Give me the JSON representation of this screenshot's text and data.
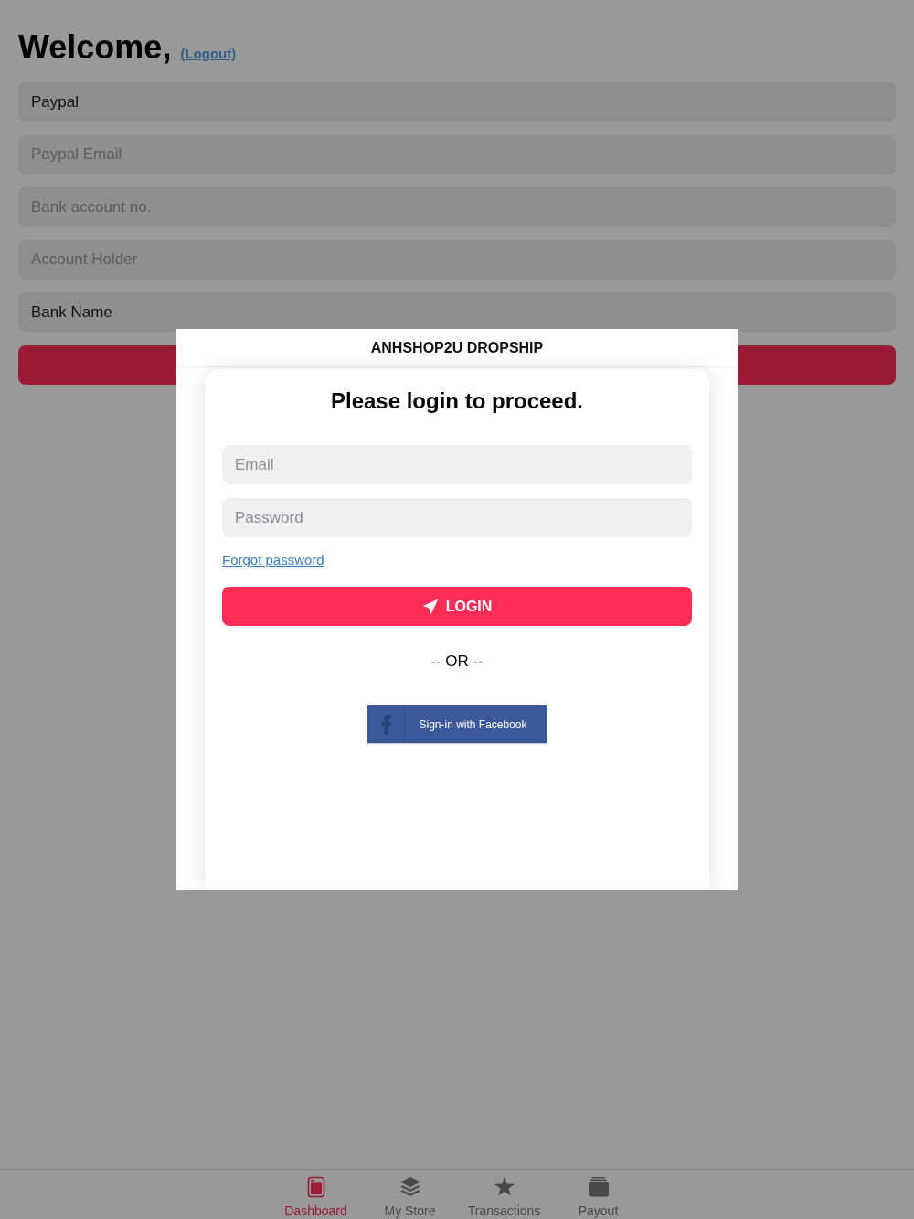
{
  "header": {
    "greeting": "Welcome,",
    "logout_link": "(Logout)"
  },
  "payout_form": {
    "fields": [
      {
        "value": "Paypal"
      },
      {
        "placeholder": "Paypal Email"
      },
      {
        "placeholder": "Bank account no."
      },
      {
        "placeholder": "Account Holder"
      },
      {
        "value": "Bank Name"
      }
    ]
  },
  "login_dialog": {
    "title": "ANHSHOP2U DROPSHIP",
    "heading": "Please login to proceed.",
    "fields": [
      {
        "placeholder": "Email"
      },
      {
        "placeholder": "Password"
      }
    ],
    "forgot_link": "Forgot password",
    "login_button": "LOGIN",
    "separator": "-- OR --",
    "facebook_button": "Sign-in with Facebook"
  },
  "tab_bar": {
    "tabs": [
      {
        "label": "Dashboard",
        "selected": true
      },
      {
        "label": "My Store",
        "selected": false
      },
      {
        "label": "Transactions",
        "selected": false
      },
      {
        "label": "Payout",
        "selected": false
      }
    ]
  }
}
